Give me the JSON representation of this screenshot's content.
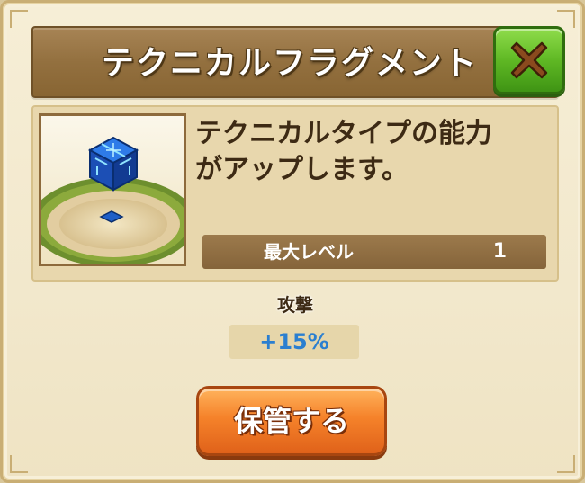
{
  "dialog": {
    "title": "テクニカルフラグメント",
    "close_icon": "close-x-icon",
    "accent_green": "#5fb824",
    "accent_orange": "#f5822a"
  },
  "item": {
    "image_icon": "blue-cube-fragment-icon",
    "description": "テクニカルタイプの能力\nがアップします。",
    "max_level_label": "最大レベル",
    "max_level_value": "1"
  },
  "stat": {
    "label": "攻撃",
    "value": "+15%"
  },
  "actions": {
    "store_label": "保管する"
  }
}
